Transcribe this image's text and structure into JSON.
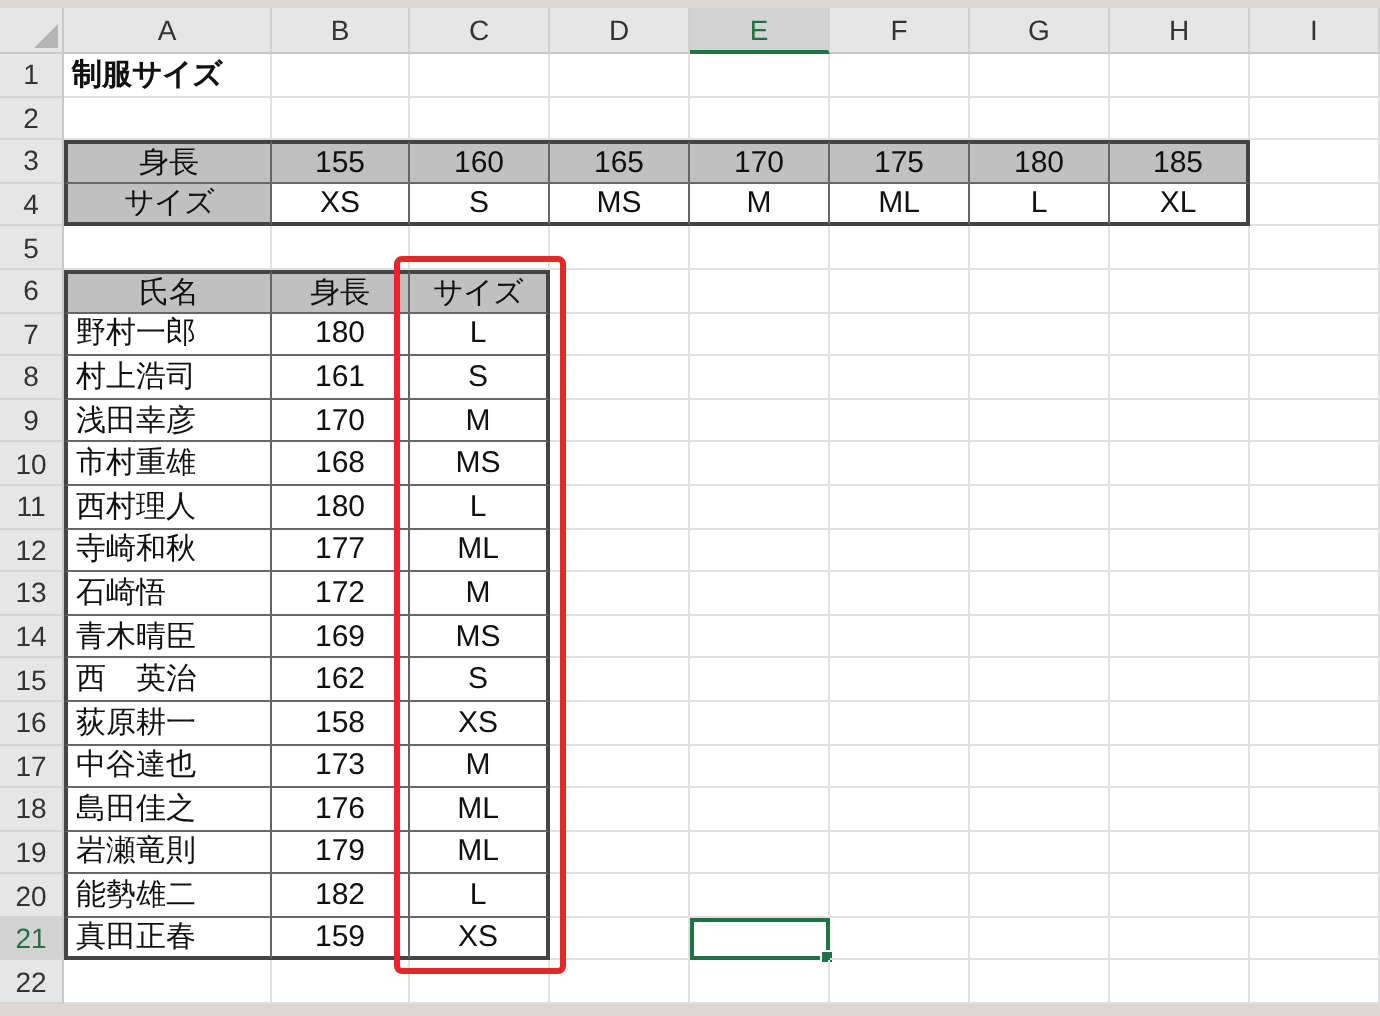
{
  "columns": [
    {
      "label": "A",
      "selected": false
    },
    {
      "label": "B",
      "selected": false
    },
    {
      "label": "C",
      "selected": false,
      "highlighted": true
    },
    {
      "label": "D",
      "selected": false
    },
    {
      "label": "E",
      "selected": true
    },
    {
      "label": "F",
      "selected": false
    },
    {
      "label": "G",
      "selected": false
    },
    {
      "label": "H",
      "selected": false
    },
    {
      "label": "I",
      "selected": false
    }
  ],
  "rows": [
    {
      "label": "1",
      "selected": false,
      "cells": [
        {
          "text": "制服サイズ",
          "kind": "title"
        }
      ]
    },
    {
      "label": "2",
      "selected": false,
      "cells": []
    },
    {
      "label": "3",
      "selected": false,
      "cells": [
        {
          "text": "身長",
          "kind": "center",
          "shaded": true,
          "boxed": true
        },
        {
          "text": "155",
          "kind": "center",
          "shaded": true,
          "boxed": true
        },
        {
          "text": "160",
          "kind": "center",
          "shaded": true,
          "boxed": true
        },
        {
          "text": "165",
          "kind": "center",
          "shaded": true,
          "boxed": true
        },
        {
          "text": "170",
          "kind": "center",
          "shaded": true,
          "boxed": true
        },
        {
          "text": "175",
          "kind": "center",
          "shaded": true,
          "boxed": true
        },
        {
          "text": "180",
          "kind": "center",
          "shaded": true,
          "boxed": true
        },
        {
          "text": "185",
          "kind": "center",
          "shaded": true,
          "boxed": true
        }
      ]
    },
    {
      "label": "4",
      "selected": false,
      "cells": [
        {
          "text": "サイズ",
          "kind": "center",
          "shaded": true,
          "boxed": true
        },
        {
          "text": "XS",
          "kind": "center",
          "boxed": true
        },
        {
          "text": "S",
          "kind": "center",
          "boxed": true
        },
        {
          "text": "MS",
          "kind": "center",
          "boxed": true
        },
        {
          "text": "M",
          "kind": "center",
          "boxed": true
        },
        {
          "text": "ML",
          "kind": "center",
          "boxed": true
        },
        {
          "text": "L",
          "kind": "center",
          "boxed": true
        },
        {
          "text": "XL",
          "kind": "center",
          "boxed": true
        }
      ]
    },
    {
      "label": "5",
      "selected": false,
      "cells": []
    },
    {
      "label": "6",
      "selected": false,
      "cells": [
        {
          "text": "氏名",
          "kind": "center",
          "shaded": true,
          "boxed": true
        },
        {
          "text": "身長",
          "kind": "center",
          "shaded": true,
          "boxed": true
        },
        {
          "text": "サイズ",
          "kind": "center",
          "shaded": true,
          "boxed": true
        }
      ]
    },
    {
      "label": "7",
      "selected": false,
      "cells": [
        {
          "text": "野村一郎",
          "kind": "text",
          "boxed": true
        },
        {
          "text": "180",
          "kind": "center",
          "boxed": true
        },
        {
          "text": "L",
          "kind": "center",
          "boxed": true
        }
      ]
    },
    {
      "label": "8",
      "selected": false,
      "cells": [
        {
          "text": "村上浩司",
          "kind": "text",
          "boxed": true
        },
        {
          "text": "161",
          "kind": "center",
          "boxed": true
        },
        {
          "text": "S",
          "kind": "center",
          "boxed": true
        }
      ]
    },
    {
      "label": "9",
      "selected": false,
      "cells": [
        {
          "text": "浅田幸彦",
          "kind": "text",
          "boxed": true
        },
        {
          "text": "170",
          "kind": "center",
          "boxed": true
        },
        {
          "text": "M",
          "kind": "center",
          "boxed": true
        }
      ]
    },
    {
      "label": "10",
      "selected": false,
      "cells": [
        {
          "text": "市村重雄",
          "kind": "text",
          "boxed": true
        },
        {
          "text": "168",
          "kind": "center",
          "boxed": true
        },
        {
          "text": "MS",
          "kind": "center",
          "boxed": true
        }
      ]
    },
    {
      "label": "11",
      "selected": false,
      "cells": [
        {
          "text": "西村理人",
          "kind": "text",
          "boxed": true
        },
        {
          "text": "180",
          "kind": "center",
          "boxed": true
        },
        {
          "text": "L",
          "kind": "center",
          "boxed": true
        }
      ]
    },
    {
      "label": "12",
      "selected": false,
      "cells": [
        {
          "text": "寺崎和秋",
          "kind": "text",
          "boxed": true
        },
        {
          "text": "177",
          "kind": "center",
          "boxed": true
        },
        {
          "text": "ML",
          "kind": "center",
          "boxed": true
        }
      ]
    },
    {
      "label": "13",
      "selected": false,
      "cells": [
        {
          "text": "石崎悟",
          "kind": "text",
          "boxed": true
        },
        {
          "text": "172",
          "kind": "center",
          "boxed": true
        },
        {
          "text": "M",
          "kind": "center",
          "boxed": true
        }
      ]
    },
    {
      "label": "14",
      "selected": false,
      "cells": [
        {
          "text": "青木晴臣",
          "kind": "text",
          "boxed": true
        },
        {
          "text": "169",
          "kind": "center",
          "boxed": true
        },
        {
          "text": "MS",
          "kind": "center",
          "boxed": true
        }
      ]
    },
    {
      "label": "15",
      "selected": false,
      "cells": [
        {
          "text": "西　英治",
          "kind": "text",
          "boxed": true
        },
        {
          "text": "162",
          "kind": "center",
          "boxed": true
        },
        {
          "text": "S",
          "kind": "center",
          "boxed": true
        }
      ]
    },
    {
      "label": "16",
      "selected": false,
      "cells": [
        {
          "text": "荻原耕一",
          "kind": "text",
          "boxed": true
        },
        {
          "text": "158",
          "kind": "center",
          "boxed": true
        },
        {
          "text": "XS",
          "kind": "center",
          "boxed": true
        }
      ]
    },
    {
      "label": "17",
      "selected": false,
      "cells": [
        {
          "text": "中谷達也",
          "kind": "text",
          "boxed": true
        },
        {
          "text": "173",
          "kind": "center",
          "boxed": true
        },
        {
          "text": "M",
          "kind": "center",
          "boxed": true
        }
      ]
    },
    {
      "label": "18",
      "selected": false,
      "cells": [
        {
          "text": "島田佳之",
          "kind": "text",
          "boxed": true
        },
        {
          "text": "176",
          "kind": "center",
          "boxed": true
        },
        {
          "text": "ML",
          "kind": "center",
          "boxed": true
        }
      ]
    },
    {
      "label": "19",
      "selected": false,
      "cells": [
        {
          "text": "岩瀬竜則",
          "kind": "text",
          "boxed": true
        },
        {
          "text": "179",
          "kind": "center",
          "boxed": true
        },
        {
          "text": "ML",
          "kind": "center",
          "boxed": true
        }
      ]
    },
    {
      "label": "20",
      "selected": false,
      "cells": [
        {
          "text": "能勢雄二",
          "kind": "text",
          "boxed": true
        },
        {
          "text": "182",
          "kind": "center",
          "boxed": true
        },
        {
          "text": "L",
          "kind": "center",
          "boxed": true
        }
      ]
    },
    {
      "label": "21",
      "selected": true,
      "cells": [
        {
          "text": "真田正春",
          "kind": "text",
          "boxed": true
        },
        {
          "text": "159",
          "kind": "center",
          "boxed": true
        },
        {
          "text": "XS",
          "kind": "center",
          "boxed": true
        },
        {},
        {
          "selected": true
        }
      ]
    },
    {
      "label": "22",
      "selected": false,
      "cells": []
    }
  ]
}
